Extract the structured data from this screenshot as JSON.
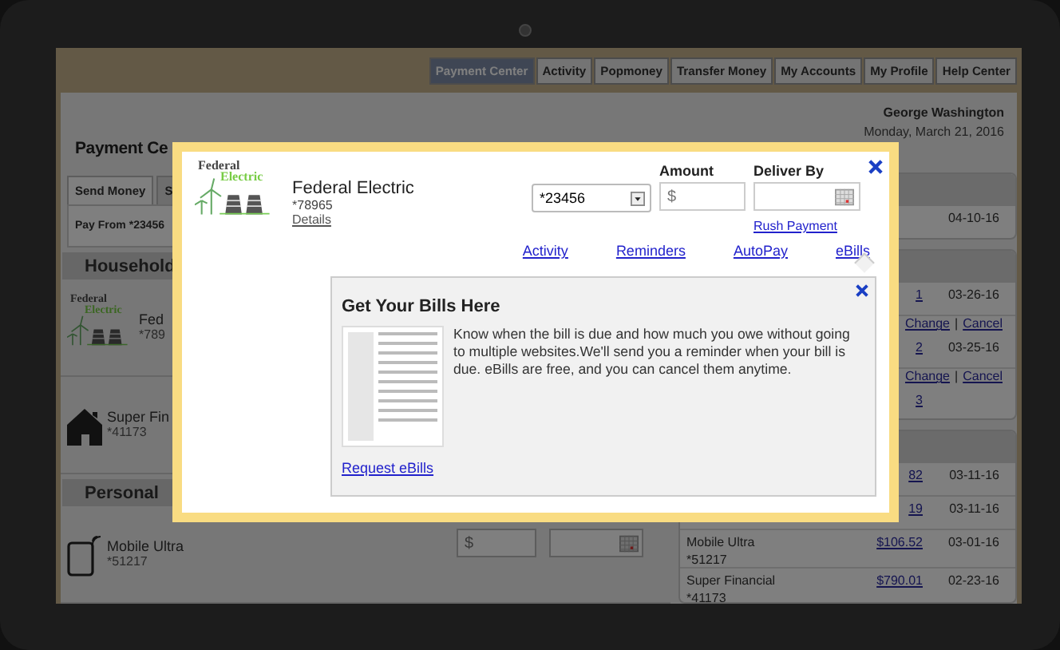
{
  "nav": [
    {
      "label": "Payment Center",
      "selected": true
    },
    {
      "label": "Activity",
      "selected": false
    },
    {
      "label": "Popmoney",
      "selected": false
    },
    {
      "label": "Transfer Money",
      "selected": false
    },
    {
      "label": "My Accounts",
      "selected": false
    },
    {
      "label": "My Profile",
      "selected": false
    },
    {
      "label": "Help Center",
      "selected": false
    }
  ],
  "user": {
    "name": "George Washington",
    "date": "Monday, March 21, 2016"
  },
  "page_title": "Payment Ce",
  "tabs": [
    {
      "label": "Send Money",
      "selected": true
    },
    {
      "label": "S",
      "selected": false
    }
  ],
  "pay_from": "Pay From *23456",
  "sections": [
    {
      "title": "Household",
      "payees": [
        {
          "kind": "logo",
          "logo": [
            "Federal",
            "Electric"
          ],
          "name": "Fed",
          "account": "*789"
        },
        {
          "kind": "house",
          "name": "Super Fin",
          "account": "*41173"
        }
      ]
    },
    {
      "title": "Personal",
      "payees": [
        {
          "kind": "phone",
          "name": "Mobile Ultra",
          "account": "*51217",
          "amount_placeholder": "$"
        }
      ]
    }
  ],
  "history": [
    {
      "rows": [
        {
          "kind": "payment",
          "date": "04-10-16"
        }
      ]
    },
    {
      "rows": [
        {
          "kind": "payment",
          "amount": "1",
          "date": "03-26-16"
        },
        {
          "kind": "actions",
          "actions": [
            "Change",
            "Cancel"
          ],
          "separator": "|"
        },
        {
          "kind": "payment",
          "amount": "2",
          "date": "03-25-16"
        },
        {
          "kind": "actions",
          "actions": [
            "Change",
            "Cancel"
          ],
          "separator": "|"
        },
        {
          "kind": "payment",
          "amount": "3"
        }
      ]
    },
    {
      "rows": [
        {
          "kind": "payment",
          "amount": "82",
          "date": "03-11-16"
        },
        {
          "kind": "payment",
          "amount": "19",
          "date": "03-11-16"
        },
        {
          "kind": "payment",
          "name": "Mobile Ultra",
          "account": "*51217",
          "amount": "$106.52",
          "date": "03-01-16"
        },
        {
          "kind": "payment",
          "name": "Super Financial",
          "account": "*41173",
          "amount": "$790.01",
          "date": "02-23-16"
        }
      ]
    }
  ],
  "modal": {
    "payee": {
      "logo": [
        "Federal",
        "Electric"
      ],
      "name": "Federal Electric",
      "account": "*78965",
      "details": "Details"
    },
    "from_account": "*23456",
    "amount": {
      "label": "Amount",
      "placeholder": "$"
    },
    "deliver_by": {
      "label": "Deliver By",
      "link": "Rush Payment"
    },
    "links": [
      {
        "label": "Activity",
        "selected": false
      },
      {
        "label": "Reminders",
        "selected": false
      },
      {
        "label": "AutoPay",
        "selected": false
      },
      {
        "label": "eBills",
        "selected": true
      }
    ],
    "ebills": {
      "title": "Get Your Bills Here",
      "text": "Know when the bill is due and how much you owe without going to multiple websites.We'll send you a reminder when your bill is due. eBills are free, and you can cancel them anytime.",
      "link": "Request eBills"
    }
  }
}
